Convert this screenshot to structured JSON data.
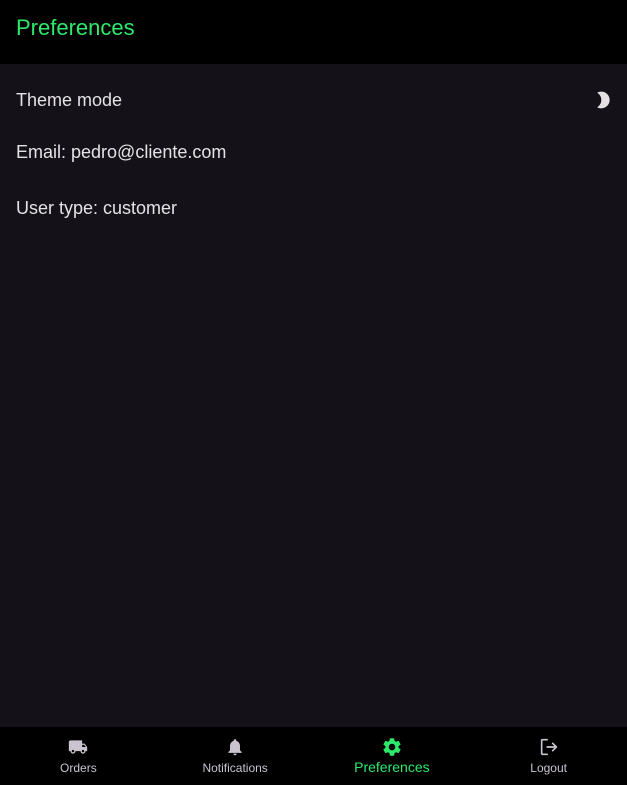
{
  "app_bar": {
    "title": "Preferences"
  },
  "settings": {
    "theme_label": "Theme mode",
    "theme_icon": "moon-icon",
    "email_line": "Email: pedro@cliente.com",
    "user_type_line": "User type: customer"
  },
  "bottom_nav": {
    "items": [
      {
        "label": "Orders",
        "icon": "truck-icon",
        "active": false
      },
      {
        "label": "Notifications",
        "icon": "bell-icon",
        "active": false
      },
      {
        "label": "Preferences",
        "icon": "gear-icon",
        "active": true
      },
      {
        "label": "Logout",
        "icon": "logout-icon",
        "active": false
      }
    ]
  },
  "colors": {
    "accent": "#2ee86a",
    "background": "#141218",
    "bar_background": "#000000",
    "text": "#e6e1e5",
    "muted": "#cac4d0"
  }
}
